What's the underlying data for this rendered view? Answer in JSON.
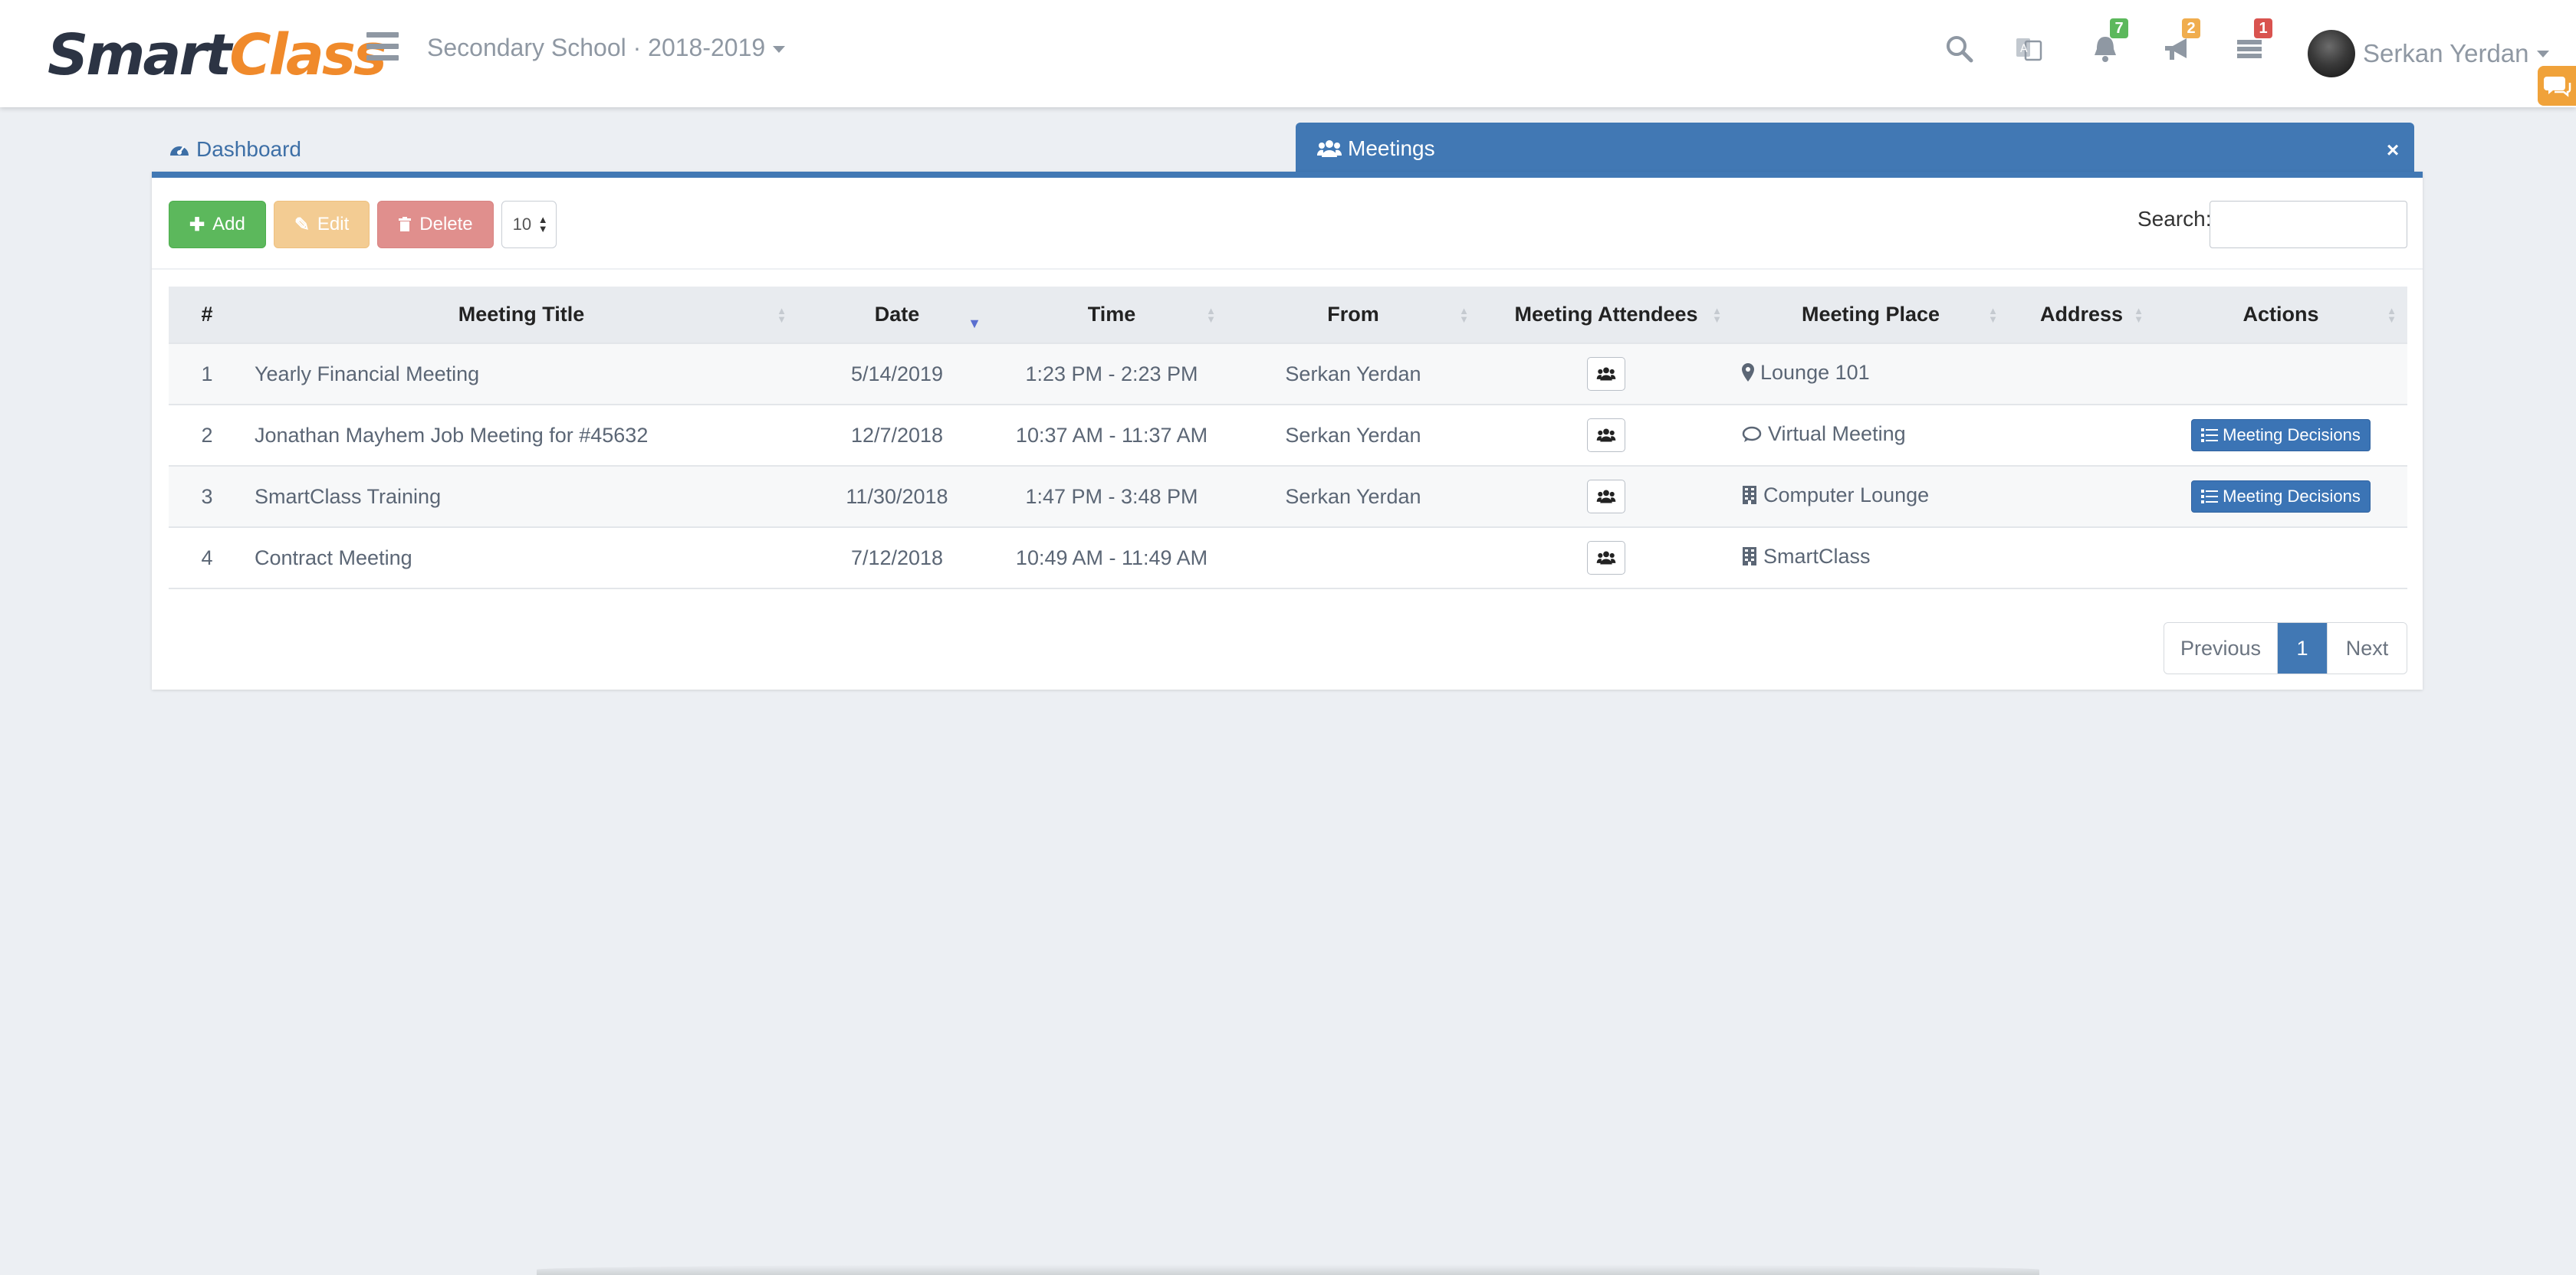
{
  "navbar": {
    "logo_part1": "Smart",
    "logo_part2": "Class",
    "school_selector": "Secondary School · 2018-2019",
    "notifications_count": "7",
    "announcements_count": "2",
    "tasks_count": "1",
    "user_name": "Serkan Yerdan",
    "colors": {
      "brand_dark": "#2c3444",
      "brand_orange": "#f08a2b",
      "badge_green": "#5cb85c",
      "badge_orange": "#f0ad4e",
      "badge_red": "#d9534f"
    },
    "icons": [
      "menu-icon",
      "search-icon",
      "translate-icon",
      "bell-icon",
      "megaphone-icon",
      "tasks-icon",
      "chat-icon"
    ]
  },
  "tabs": {
    "dashboard": "Dashboard",
    "meetings": "Meetings",
    "close": "×"
  },
  "toolbar": {
    "add": "Add",
    "edit": "Edit",
    "delete": "Delete",
    "page_size": "10",
    "search_label": "Search:",
    "search_value": ""
  },
  "table": {
    "columns": [
      "#",
      "Meeting Title",
      "Date",
      "Time",
      "From",
      "Meeting Attendees",
      "Meeting Place",
      "Address",
      "Actions"
    ],
    "sorted_by": "Date",
    "rows": [
      {
        "num": "1",
        "title": "Yearly Financial Meeting",
        "date": "5/14/2019",
        "time": "1:23 PM - 2:23 PM",
        "from": "Serkan Yerdan",
        "place_icon": "map-marker-icon",
        "place": "Lounge 101",
        "address": "",
        "action": ""
      },
      {
        "num": "2",
        "title": "Jonathan Mayhem Job Meeting for #45632",
        "date": "12/7/2018",
        "time": "10:37 AM - 11:37 AM",
        "from": "Serkan Yerdan",
        "place_icon": "comment-icon",
        "place": "Virtual Meeting",
        "address": "",
        "action": "Meeting Decisions"
      },
      {
        "num": "3",
        "title": "SmartClass Training",
        "date": "11/30/2018",
        "time": "1:47 PM - 3:48 PM",
        "from": "Serkan Yerdan",
        "place_icon": "building-icon",
        "place": "Computer Lounge",
        "address": "",
        "action": "Meeting Decisions"
      },
      {
        "num": "4",
        "title": "Contract Meeting",
        "date": "7/12/2018",
        "time": "10:49 AM - 11:49 AM",
        "from": "",
        "place_icon": "building-icon",
        "place": "SmartClass",
        "address": "",
        "action": ""
      }
    ]
  },
  "pagination": {
    "previous": "Previous",
    "current": "1",
    "next": "Next"
  }
}
